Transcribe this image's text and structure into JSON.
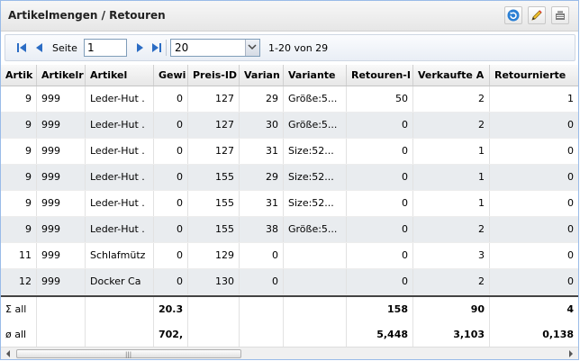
{
  "title": "Artikelmengen / Retouren",
  "toolbar": {
    "refresh": "refresh-icon",
    "edit": "pencil-icon",
    "export": "export-icon"
  },
  "pager": {
    "page_label": "Seite",
    "page_value": "1",
    "page_size": "20",
    "info": "1-20 von 29"
  },
  "columns": [
    "Artik",
    "Artikelr",
    "Artikel",
    "Gewi",
    "Preis-ID",
    "Varian",
    "Variante",
    "Retouren-I",
    "Verkaufte A",
    "Retournierte"
  ],
  "rows": [
    [
      "9",
      "999",
      "Leder-Hut .",
      "0",
      "127",
      "29",
      "Größe:5...",
      "50",
      "2",
      "1"
    ],
    [
      "9",
      "999",
      "Leder-Hut .",
      "0",
      "127",
      "30",
      "Größe:5...",
      "0",
      "2",
      "0"
    ],
    [
      "9",
      "999",
      "Leder-Hut .",
      "0",
      "127",
      "31",
      "Size:52...",
      "0",
      "1",
      "0"
    ],
    [
      "9",
      "999",
      "Leder-Hut .",
      "0",
      "155",
      "29",
      "Size:52...",
      "0",
      "1",
      "0"
    ],
    [
      "9",
      "999",
      "Leder-Hut .",
      "0",
      "155",
      "31",
      "Size:52...",
      "0",
      "1",
      "0"
    ],
    [
      "9",
      "999",
      "Leder-Hut .",
      "0",
      "155",
      "38",
      "Größe:5...",
      "0",
      "2",
      "0"
    ],
    [
      "11",
      "999",
      "Schlafmütz",
      "0",
      "129",
      "0",
      "",
      "0",
      "3",
      "0"
    ],
    [
      "12",
      "999",
      "Docker Ca",
      "0",
      "130",
      "0",
      "",
      "0",
      "2",
      "0"
    ]
  ],
  "summary": [
    [
      "Σ all",
      "",
      "",
      "20.3",
      "",
      "",
      "",
      "158",
      "90",
      "4"
    ],
    [
      "ø all",
      "",
      "",
      "702,",
      "",
      "",
      "",
      "5,448",
      "3,103",
      "0,138"
    ]
  ]
}
